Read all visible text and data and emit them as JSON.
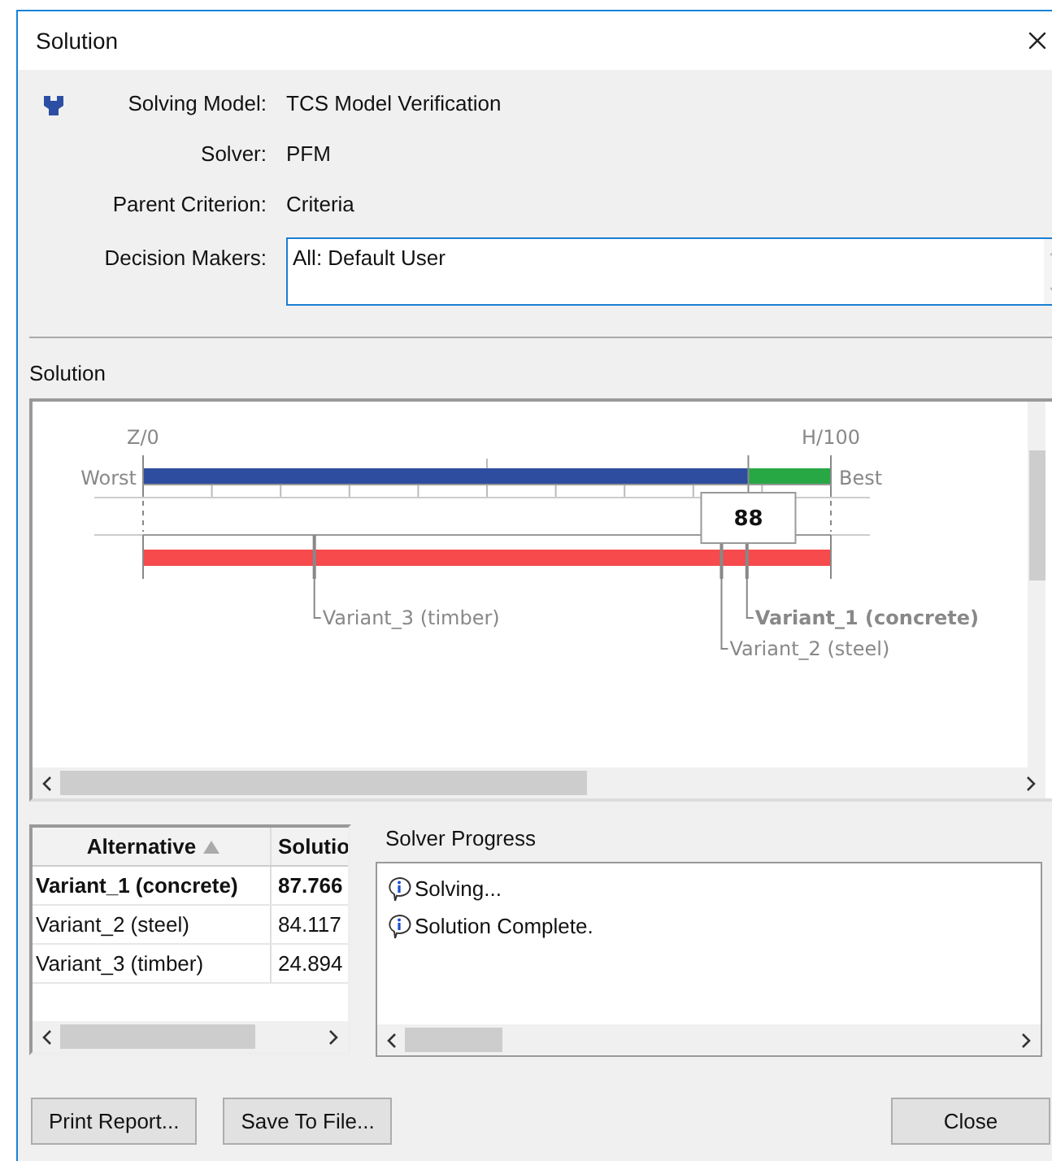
{
  "window": {
    "title": "Solution"
  },
  "info": [
    {
      "label": "Solving Model:",
      "value": "TCS Model Verification"
    },
    {
      "label": "Solver:",
      "value": "PFM"
    },
    {
      "label": "Parent Criterion:",
      "value": "Criteria"
    }
  ],
  "decision_makers": {
    "label": "Decision Makers:",
    "value": "All: Default User"
  },
  "solution": {
    "title": "Solution",
    "scale": {
      "min_label": "Z/0",
      "max_label": "H/100",
      "worst_label": "Worst",
      "best_label": "Best",
      "level": 0.88,
      "marker": "88"
    },
    "alternatives": [
      {
        "name": "Variant_1 (concrete)",
        "level": 0.878,
        "best": true
      },
      {
        "name": "Variant_2 (steel)",
        "level": 0.841,
        "best": false
      },
      {
        "name": "Variant_3 (timber)",
        "level": 0.249,
        "best": false
      }
    ]
  },
  "table": {
    "columns": [
      "Alternative",
      "Solutio"
    ],
    "rows": [
      {
        "cells": [
          "Variant_1 (concrete)",
          "87.766"
        ],
        "best": true
      },
      {
        "cells": [
          "Variant_2 (steel)",
          "84.117"
        ],
        "best": false
      },
      {
        "cells": [
          "Variant_3 (timber)",
          "24.894"
        ],
        "best": false
      }
    ]
  },
  "progress": {
    "title": "Solver Progress",
    "messages": [
      "Solving...",
      "Solution Complete."
    ]
  },
  "buttons": {
    "left": [
      "Print Report...",
      "Save To File..."
    ],
    "right": "Close"
  }
}
